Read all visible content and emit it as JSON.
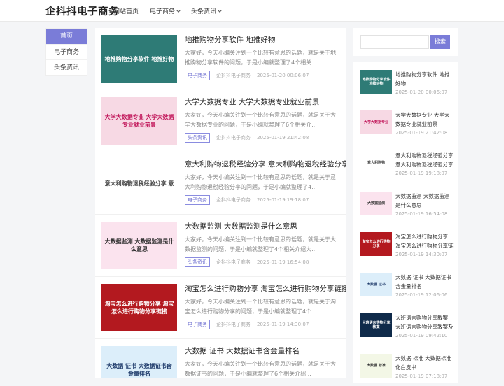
{
  "site": {
    "logo": "企抖抖电子商务"
  },
  "nav": [
    {
      "label": "网站首页"
    },
    {
      "label": "电子商务"
    },
    {
      "label": "头条资讯"
    }
  ],
  "leftnav": [
    {
      "label": "首页"
    },
    {
      "label": "电子商务"
    },
    {
      "label": "头条资讯"
    }
  ],
  "articles": [
    {
      "title": "地推购物分享软件 地推好物",
      "excerpt": "大家好，今天小编关注到一个比较有意思的话题，就是关于地推购物分享软件的问题，于是小编就整理了4个相关...",
      "tag": "电子商务",
      "author": "企抖抖电子商务",
      "date": "2025-01-20 00:06:07",
      "thumb_text": "地推购物分享软件 地推好物",
      "thumb_bg": "#2e7b76",
      "thumb_fg": "#ffffff"
    },
    {
      "title": "大学大数据专业 大学大数据专业就业前景",
      "excerpt": "大家好，今天小编关注到一个比较有意思的话题，就是关于大学大数据专业的问题，于是小编就整理了6个相关介...",
      "tag": "头条资讯",
      "author": "企抖抖电子商务",
      "date": "2025-01-19 21:42:08",
      "thumb_text": "大学大数据专业 大学大数据专业就业前景",
      "thumb_bg": "#f7d9e4",
      "thumb_fg": "#c2185b"
    },
    {
      "title": "意大利购物退税经验分享 意大利购物退税经验分享",
      "excerpt": "大家好，今天小编关注到一个比较有意思的话题，就是关于意大利购物退税经验分享的问题，于是小编就整理了4...",
      "tag": "电子商务",
      "author": "企抖抖电子商务",
      "date": "2025-01-19 19:18:07",
      "thumb_text": "意大利购物退税经验分享 意",
      "thumb_bg": "#ffffff",
      "thumb_fg": "#444444"
    },
    {
      "title": "大数据监测 大数据监测是什么意思",
      "excerpt": "大家好，今天小编关注到一个比较有意思的话题，就是关于大数据监测的问题，于是小编就整理了4个相关介绍大...",
      "tag": "头条资讯",
      "author": "企抖抖电子商务",
      "date": "2025-01-19 16:54:08",
      "thumb_text": "大数据监测 大数据监测是什么意思",
      "thumb_bg": "#fbe3ee",
      "thumb_fg": "#333333"
    },
    {
      "title": "淘宝怎么进行购物分享 淘宝怎么进行购物分享链接",
      "excerpt": "大家好，今天小编关注到一个比较有意思的话题，就是关于淘宝怎么进行购物分享的问题，于是小编就整理了4个...",
      "tag": "电子商务",
      "author": "企抖抖电子商务",
      "date": "2025-01-19 14:30:07",
      "thumb_text": "淘宝怎么进行购物分享 淘宝怎么进行购物分享链接",
      "thumb_bg": "#b3191f",
      "thumb_fg": "#ffffff"
    },
    {
      "title": "大数据 证书 大数据证书含金量排名",
      "excerpt": "大家好，今天小编关注到一个比较有意思的话题，就是关于大数据证书的问题，于是小编就整理了6个相关介绍...",
      "tag": "头条资讯",
      "author": "企抖抖电子商务",
      "date": "2025-01-19 12:06:06",
      "thumb_text": "大数据 证书 大数据证书含金量排名",
      "thumb_bg": "#dceefa",
      "thumb_fg": "#1f3b6b"
    }
  ],
  "search": {
    "placeholder": "",
    "button": "搜索"
  },
  "hot": [
    {
      "title": "地推购物分享软件 地推好物",
      "date": "2025-01-20 00:06:07",
      "thumb_text": "地推购物分享软件 地推好物",
      "thumb_bg": "#2e7b76",
      "thumb_fg": "#ffffff"
    },
    {
      "title": "大学大数据专业 大学大数据专业就业前景",
      "date": "2025-01-19 21:42:08",
      "thumb_text": "大学大数据专业",
      "thumb_bg": "#f7d9e4",
      "thumb_fg": "#c2185b"
    },
    {
      "title": "意大利购物退税经验分享 意大利购物退税经验分享",
      "date": "2025-01-19 19:18:07",
      "thumb_text": "意大利购物",
      "thumb_bg": "#ffffff",
      "thumb_fg": "#444444"
    },
    {
      "title": "大数据监测 大数据监测是什么意思",
      "date": "2025-01-19 16:54:08",
      "thumb_text": "大数据监测",
      "thumb_bg": "#fbe3ee",
      "thumb_fg": "#333333"
    },
    {
      "title": "淘宝怎么进行购物分享 淘宝怎么进行购物分享链接",
      "date": "2025-01-19 14:30:07",
      "thumb_text": "淘宝怎么进行购物分享",
      "thumb_bg": "#b3191f",
      "thumb_fg": "#ffffff"
    },
    {
      "title": "大数据 证书 大数据证书含金量排名",
      "date": "2025-01-19 12:06:06",
      "thumb_text": "大数据 证书",
      "thumb_bg": "#dceefa",
      "thumb_fg": "#1f3b6b"
    },
    {
      "title": "大班语言购物分享教案 大班语言购物分享教案及反",
      "date": "2025-01-19 09:42:10",
      "thumb_text": "大班语言购物分享教案",
      "thumb_bg": "#0f2a4a",
      "thumb_fg": "#ffffff"
    },
    {
      "title": "大数据 标准 大数据标准化白皮书",
      "date": "2025-01-19 07:18:07",
      "thumb_text": "大数据 标准",
      "thumb_bg": "#f3f7e6",
      "thumb_fg": "#333333"
    }
  ]
}
